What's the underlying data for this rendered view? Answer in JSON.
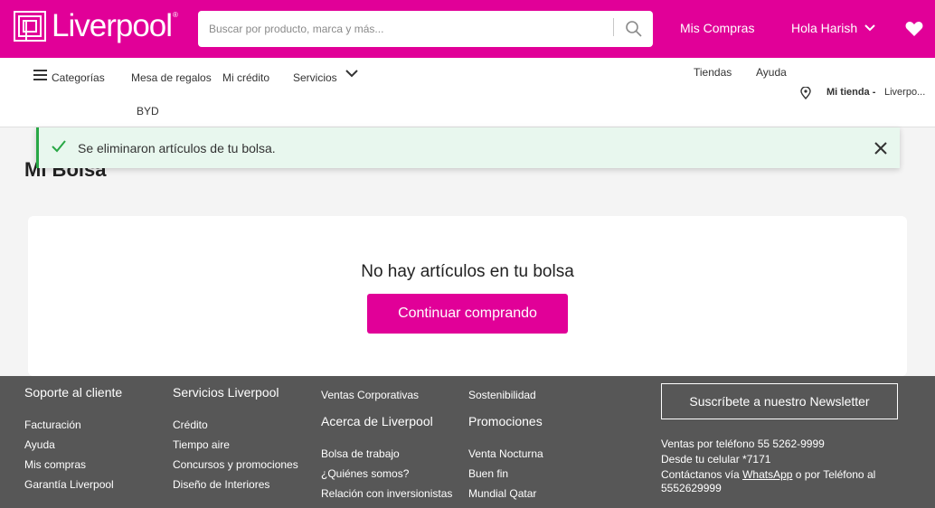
{
  "header": {
    "logo_text": "Liverpool",
    "search_placeholder": "Buscar por producto, marca y más...",
    "mis_compras": "Mis Compras",
    "greeting": "Hola Harish"
  },
  "nav": {
    "categorias": "Categorías",
    "mesa_regalos": "Mesa de regalos",
    "mi_credito": "Mi crédito",
    "servicios": "Servicios",
    "byd": "BYD",
    "tiendas": "Tiendas",
    "ayuda": "Ayuda",
    "mi_tienda_label": "Mi tienda -",
    "mi_tienda_value": "Liverpo..."
  },
  "toast": {
    "message": "Se eliminaron artículos de tu bolsa."
  },
  "page": {
    "title": "Mi Bolsa",
    "empty_message": "No hay artículos en tu bolsa",
    "continue_button": "Continuar comprando"
  },
  "footer": {
    "col1": {
      "heading": "Soporte al cliente",
      "links": [
        "Facturación",
        "Ayuda",
        "Mis compras",
        "Garantía Liverpool"
      ]
    },
    "col2": {
      "heading": "Servicios Liverpool",
      "links": [
        "Crédito",
        "Tiempo aire",
        "Concursos y promociones",
        "Diseño de Interiores"
      ]
    },
    "col3": {
      "top_link": "Ventas Corporativas",
      "heading": "Acerca de Liverpool",
      "links": [
        "Bolsa de trabajo",
        "¿Quiénes somos?",
        "Relación con inversionistas"
      ]
    },
    "col4": {
      "top_link": "Sostenibilidad",
      "heading": "Promociones",
      "links": [
        "Venta Nocturna",
        "Buen fin",
        "Mundial Qatar"
      ]
    },
    "newsletter_button": "Suscríbete a nuestro Newsletter",
    "contact": {
      "phone_line": "Ventas por teléfono 55 5262-9999",
      "cell_line": "Desde tu celular *7171",
      "contact_prefix": "Contáctanos vía",
      "whatsapp": "WhatsApp",
      "contact_suffix": "o por Teléfono al",
      "phone_number": "5552629999"
    }
  },
  "colors": {
    "brand_pink": "#e10098",
    "success_green": "#28a745",
    "footer_gray": "#575757"
  }
}
